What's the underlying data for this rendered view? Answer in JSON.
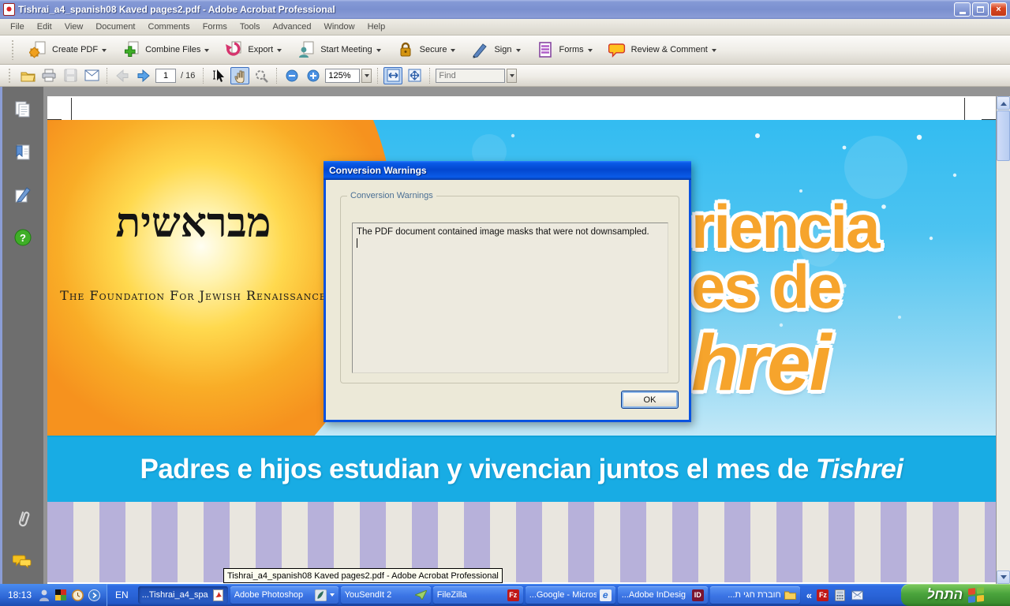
{
  "window": {
    "title": "Tishrai_a4_spanish08 Kaved pages2.pdf - Adobe Acrobat Professional"
  },
  "menu": {
    "items": [
      "File",
      "Edit",
      "View",
      "Document",
      "Comments",
      "Forms",
      "Tools",
      "Advanced",
      "Window",
      "Help"
    ]
  },
  "toolbar_main": {
    "buttons": [
      {
        "label": "Create PDF"
      },
      {
        "label": "Combine Files"
      },
      {
        "label": "Export"
      },
      {
        "label": "Start Meeting"
      },
      {
        "label": "Secure"
      },
      {
        "label": "Sign"
      },
      {
        "label": "Forms"
      },
      {
        "label": "Review & Comment"
      }
    ]
  },
  "toolbar_nav": {
    "page_value": "1",
    "page_total": "/ 16",
    "zoom_value": "125%",
    "find_placeholder": "Find"
  },
  "document": {
    "logo_hebrew": "מבראשית",
    "foundation": "The Foundation For Jewish Renaissance",
    "headline_line1": "riencia",
    "headline_line2": "es de",
    "headline_line3": "hrei",
    "banner_main": "Padres e hijos estudian y vivencian juntos el mes de",
    "banner_italic": "Tishrei"
  },
  "dialog": {
    "title": "Conversion Warnings",
    "group_label": "Conversion Warnings",
    "message": "The PDF document contained image masks that were not downsampled.",
    "ok_label": "OK"
  },
  "tooltip": "Tishrai_a4_spanish08 Kaved pages2.pdf - Adobe Acrobat Professional",
  "taskbar": {
    "clock": "18:13",
    "language": "EN",
    "buttons": [
      {
        "label": "...Tishrai_a4_spa"
      },
      {
        "label": "Adobe Photoshop"
      },
      {
        "label": "YouSendIt 2"
      },
      {
        "label": "FileZilla"
      },
      {
        "label": "...Google - Micros"
      },
      {
        "label": "...Adobe InDesig"
      },
      {
        "label": "חוברת חגי ת..."
      }
    ],
    "chevron": "«",
    "start_label": "התחל"
  },
  "glyphs": {
    "help": "?",
    "filezilla": "Fz",
    "indesign": "ID",
    "ie": "e",
    "close": "×"
  },
  "colors": {
    "taskbar_blue": "#2a64d8",
    "start_green": "#4aa33c",
    "banner_cyan": "#18ace4",
    "accent_orange": "#f6a42c",
    "dialog_title_blue": "#0a53e0"
  }
}
